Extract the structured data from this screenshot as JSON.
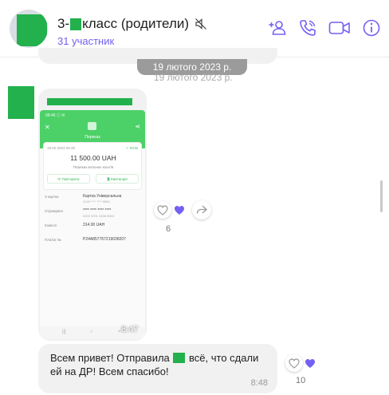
{
  "header": {
    "title_prefix": "3-",
    "title_suffix": "класс (родители)",
    "subtitle": "31 участник",
    "icons": [
      "mute-icon",
      "add-participant-icon",
      "call-icon",
      "video-call-icon",
      "info-icon"
    ]
  },
  "chat": {
    "date_separator": "19 лютого 2023 р.",
    "date_shadow": "19 лютого 2023 р.",
    "messages": [
      {
        "type": "image",
        "time": "8:47",
        "likes": "6",
        "screenshot": {
          "status_bar": "08:46 ⓘ ✉",
          "close": "✕",
          "share": "⋖",
          "title": "Переказ",
          "date": "19.02.2023 08:46",
          "status": "✓ Успіх",
          "amount": "11 500.00 UAH",
          "description": "Переказ власних коштів",
          "repeat_button": "⟳ Повторити",
          "receipt_button": "🗎 Квитанція",
          "rows": [
            {
              "label": "З картки",
              "value": "Картка Універсальна",
              "sub": "4149 **** **** 5896"
            },
            {
              "label": "Отримувач",
              "value": "**** **** **** ****",
              "sub": "4402 3291 3468 5563"
            },
            {
              "label": "Комісія",
              "value": "314.00 UAH",
              "sub": ""
            },
            {
              "label": "Платіж №",
              "value": "P24A857767219038207",
              "sub": ""
            }
          ],
          "nav": [
            "|||",
            "○",
            "<"
          ]
        }
      },
      {
        "type": "text",
        "line1_before": "Всем привет! Отправила",
        "line1_after": "всё, что сдали",
        "line2": "ей на ДР! Всем спасибо!",
        "time": "8:48",
        "likes": "10"
      }
    ]
  },
  "colors": {
    "accent": "#7360f2",
    "redaction": "#22b14c",
    "bubble": "#f1f1f1",
    "date_pill": "#9b9b9b"
  }
}
